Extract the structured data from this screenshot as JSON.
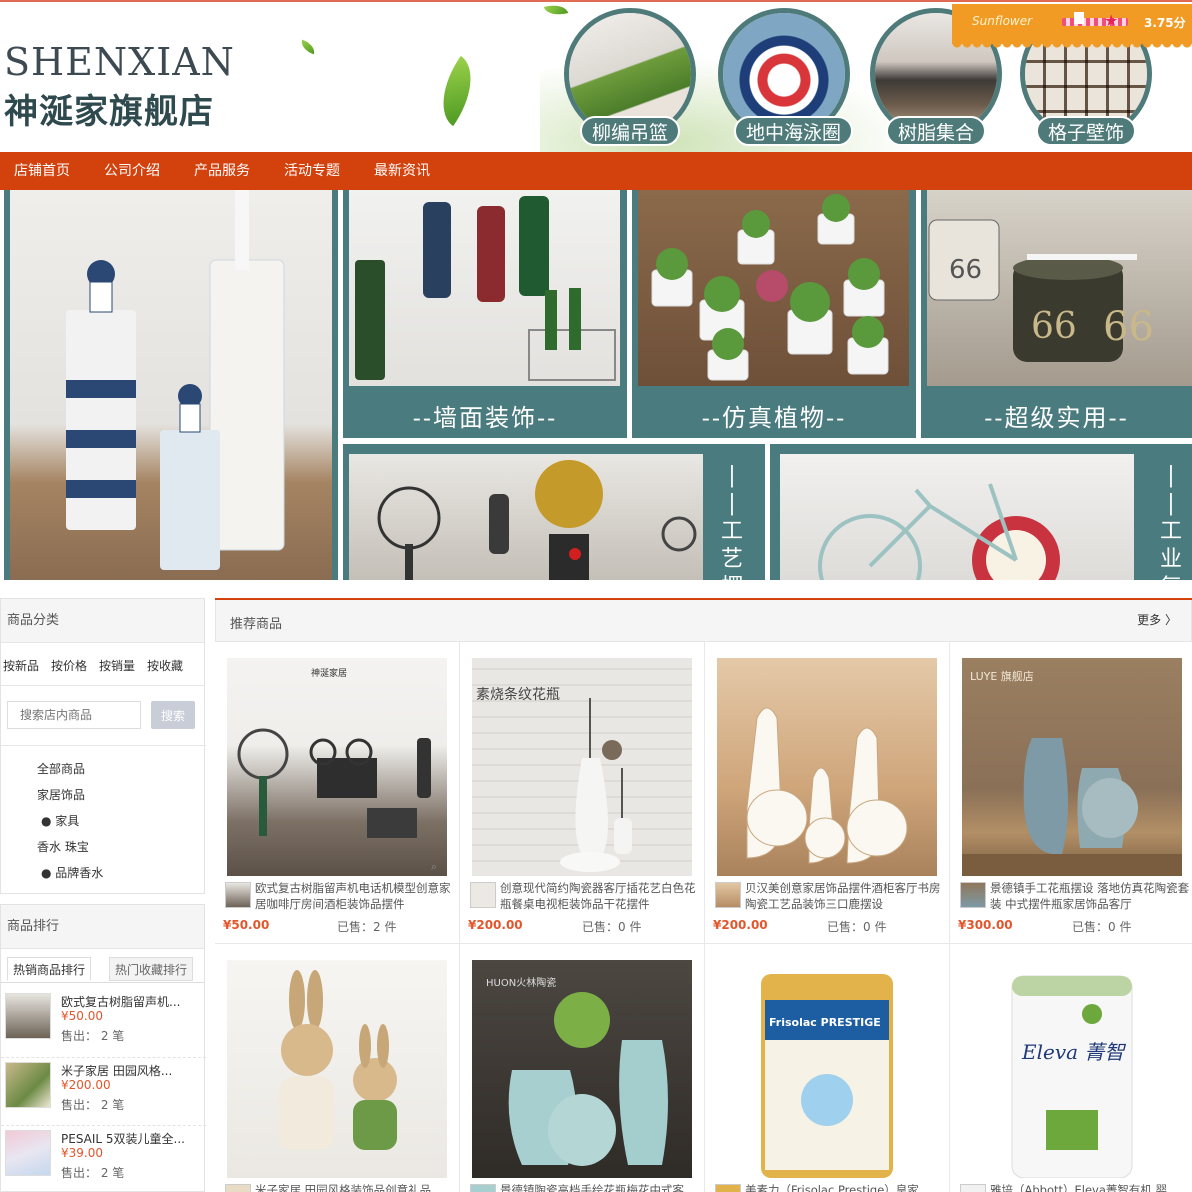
{
  "brand": {
    "name_en": "SHENXIAN",
    "name_cn": "神涎家旗舰店"
  },
  "header_categories": [
    {
      "label": "柳编吊篮",
      "icon": "hanging-basket-photo"
    },
    {
      "label": "地中海泳圈",
      "icon": "life-ring-photo"
    },
    {
      "label": "树脂集合",
      "icon": "resin-collection-photo"
    },
    {
      "label": "格子壁饰",
      "icon": "grid-shelf-photo"
    }
  ],
  "rating": {
    "name": "Sunflower",
    "score": "3.75分"
  },
  "nav": [
    "店铺首页",
    "公司介绍",
    "产品服务",
    "活动专题",
    "最新资讯"
  ],
  "banner": {
    "captions": [
      "--墙面装饰--",
      "--仿真植物--",
      "--超级实用--"
    ],
    "vcaptions": [
      "--工艺摆",
      "--工业复"
    ]
  },
  "sidebar": {
    "category_title": "商品分类",
    "sorts": [
      "按新品",
      "按价格",
      "按销量",
      "按收藏"
    ],
    "search_placeholder": "搜索店内商品",
    "search_button": "搜索",
    "categories": [
      "全部商品",
      "家居饰品",
      "● 家具",
      "香水 珠宝",
      "● 品牌香水"
    ],
    "rank_title": "商品排行",
    "rank_tabs": [
      "热销商品排行",
      "热门收藏排行"
    ],
    "rank_items": [
      {
        "title": "欧式复古树脂留声机...",
        "price": "¥50.00",
        "sold": "售出： 2 笔"
      },
      {
        "title": "米子家居 田园风格...",
        "price": "¥200.00",
        "sold": "售出： 2 笔"
      },
      {
        "title": "PESAIL 5双装儿童全...",
        "price": "¥39.00",
        "sold": "售出： 2 笔"
      }
    ]
  },
  "main": {
    "title": "推荐商品",
    "more": "更多 〉",
    "products": [
      {
        "title": "欧式复古树脂留声机电话机模型创意家居咖啡厅房间酒柜装饰品摆件",
        "price": "¥50.00",
        "sold": "已售：2 件",
        "img_label": "神涎家居"
      },
      {
        "title": "创意现代简约陶瓷器客厅插花艺白色花瓶餐桌电视柜装饰品干花摆件",
        "price": "¥200.00",
        "sold": "已售：0 件",
        "img_label": "素烧条纹花瓶"
      },
      {
        "title": "贝汉美创意家居饰品摆件酒柜客厅书房陶瓷工艺品装饰三口鹿摆设",
        "price": "¥200.00",
        "sold": "已售：0 件",
        "img_label": ""
      },
      {
        "title": "景德镇手工花瓶摆设 落地仿真花陶瓷套装 中式摆件瓶家居饰品客厅",
        "price": "¥300.00",
        "sold": "已售：0 件",
        "img_label": "LUYE 旗舰店"
      },
      {
        "title": "米子家居 田园风格装饰品创意礼品",
        "price": "",
        "sold": "",
        "img_label": ""
      },
      {
        "title": "景德镇陶瓷高档手绘花瓶梅花中式客",
        "price": "",
        "sold": "",
        "img_label": "HUON火林陶瓷"
      },
      {
        "title": "美素力（Frisolac Prestige）皇家",
        "price": "",
        "sold": "",
        "img_label": "Frisolac PRESTIGE"
      },
      {
        "title": "雅培（Abbott）Eleva菁智有机 婴",
        "price": "",
        "sold": "",
        "img_label": "Eleva 菁智"
      }
    ]
  },
  "colors": {
    "nav": "#d3410d",
    "teal": "#4a7b7e",
    "price": "#e3562c",
    "rating": "#f29b24"
  }
}
